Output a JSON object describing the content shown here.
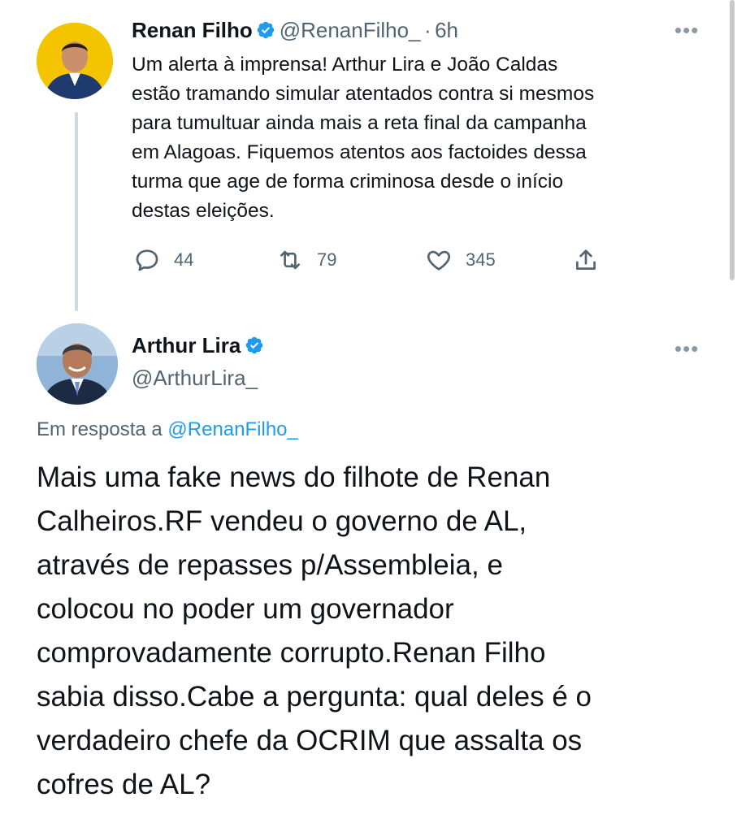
{
  "tweet1": {
    "author_name": "Renan Filho",
    "handle": "@RenanFilho_",
    "separator": "·",
    "time": "6h",
    "text": "Um alerta à imprensa! Arthur Lira e João Caldas estão tramando simular atentados contra si mesmos para tumultuar ainda mais a reta final da campanha em Alagoas. Fiquemos atentos aos factoides dessa turma que age de forma criminosa desde o início destas eleições.",
    "lines": [
      "Um alerta à imprensa! Arthur Lira e João Caldas",
      "estão tramando simular atentados contra si mesmos",
      "para tumultuar ainda mais a reta final da campanha",
      "em Alagoas. Fiquemos atentos aos factoides dessa",
      "turma que age de forma criminosa desde o início",
      "destas eleições."
    ],
    "replies": "44",
    "retweets": "79",
    "likes": "345",
    "more_label": "•••"
  },
  "tweet2": {
    "author_name": "Arthur Lira",
    "handle": "@ArthurLira_",
    "reply_prefix": "Em resposta a",
    "reply_handle": "@RenanFilho_",
    "lines": [
      "Mais uma fake news do filhote de Renan",
      "Calheiros.RF vendeu o governo de AL,",
      "através de repasses p/Assembleia, e",
      "colocou no poder um governador",
      "comprovadamente corrupto.Renan Filho",
      "sabia disso.Cabe a pergunta: qual deles é o",
      "verdadeiro chefe da OCRIM que assalta os",
      "cofres de AL?"
    ],
    "more_label": "•••"
  },
  "colors": {
    "accent": "#1d9bf0",
    "secondary_text": "#536471",
    "avatar1_bg": "#f5c400",
    "avatar2_bg": "#8fb4d8"
  },
  "icons": [
    "verified-badge-icon",
    "reply-icon",
    "retweet-icon",
    "like-icon",
    "share-icon",
    "more-icon"
  ]
}
